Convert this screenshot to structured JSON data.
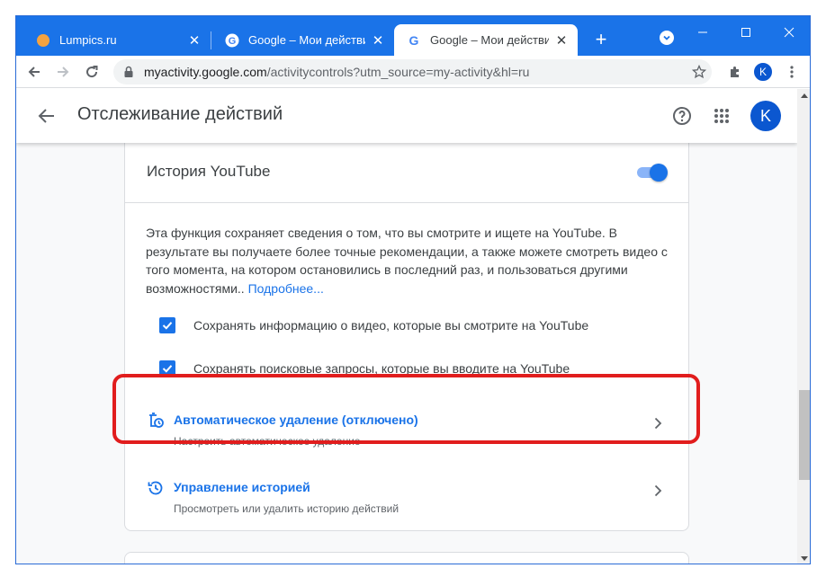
{
  "browser": {
    "tabs": [
      {
        "title": "Lumpics.ru",
        "favicon": "lumpics-orange-circle-icon",
        "active": false
      },
      {
        "title": "Google – Мои действия",
        "favicon": "google-g-icon",
        "active": false
      },
      {
        "title": "Google – Мои действия",
        "favicon": "google-g-icon",
        "active": true
      }
    ],
    "url_host": "myactivity.google.com",
    "url_path": "/activitycontrols?utm_source=my-activity&hl=ru",
    "profile_initial": "K",
    "accent": "#1a73e8"
  },
  "appbar": {
    "title": "Отслеживание действий",
    "avatar_initial": "K"
  },
  "card": {
    "title": "История YouTube",
    "toggle_on": true,
    "description": "Эта функция сохраняет сведения о том, что вы смотрите и ищете на YouTube. В результате вы получаете более точные рекомендации, а также можете смотреть видео с того момента, на котором остановились в последний раз, и пользоваться другими возможностями.. ",
    "more_link": "Подробнее...",
    "checkboxes": [
      {
        "label": "Сохранять информацию о видео, которые вы смотрите на YouTube",
        "checked": true
      },
      {
        "label": "Сохранять поисковые запросы, которые вы вводите на YouTube",
        "checked": true
      }
    ],
    "links": [
      {
        "title": "Автоматическое удаление (отключено)",
        "subtitle": "Настроить автоматическое удаление",
        "icon": "auto-delete-icon"
      },
      {
        "title": "Управление историей",
        "subtitle": "Просмотреть или удалить историю действий",
        "icon": "history-icon"
      }
    ]
  },
  "highlight_color": "#e11d1d"
}
